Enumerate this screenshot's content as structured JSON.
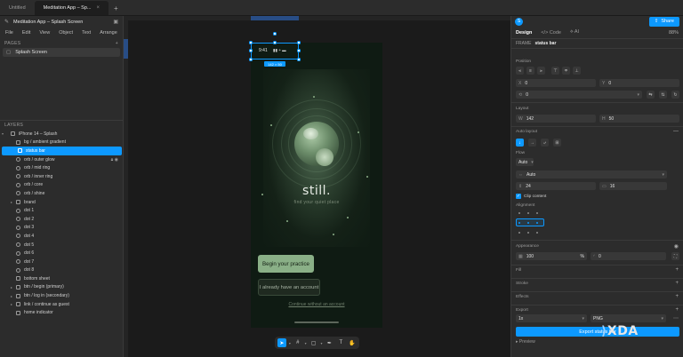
{
  "tabs": [
    {
      "label": "Untitled",
      "active": false
    },
    {
      "label": "Meditation App – Sp...",
      "active": true
    }
  ],
  "file": {
    "name": "Meditation App – Splash Screen"
  },
  "menu": [
    "File",
    "Edit",
    "View",
    "Object",
    "Text",
    "Arrange"
  ],
  "pages": {
    "header": "PAGES",
    "items": [
      "Splash Screen"
    ]
  },
  "layers": {
    "header": "LAYERS",
    "items": [
      {
        "label": "iPhone 14 – Splash",
        "type": "frame",
        "level": 0,
        "expanded": true
      },
      {
        "label": "bg / ambient gradient",
        "type": "rect",
        "level": 1
      },
      {
        "label": "status bar",
        "type": "frame",
        "level": 1,
        "selected": true
      },
      {
        "label": "orb / outer glow",
        "type": "ellipse",
        "level": 1,
        "locked": true,
        "visible": true
      },
      {
        "label": "orb / mid ring",
        "type": "ellipse",
        "level": 1
      },
      {
        "label": "orb / inner ring",
        "type": "ellipse",
        "level": 1
      },
      {
        "label": "orb / core",
        "type": "ellipse",
        "level": 1
      },
      {
        "label": "orb / shine",
        "type": "ellipse",
        "level": 1
      },
      {
        "label": "brand",
        "type": "group",
        "level": 1
      },
      {
        "label": "dot 1",
        "type": "ellipse",
        "level": 1
      },
      {
        "label": "dot 2",
        "type": "ellipse",
        "level": 1
      },
      {
        "label": "dot 3",
        "type": "ellipse",
        "level": 1
      },
      {
        "label": "dot 4",
        "type": "ellipse",
        "level": 1
      },
      {
        "label": "dot 5",
        "type": "ellipse",
        "level": 1
      },
      {
        "label": "dot 6",
        "type": "ellipse",
        "level": 1
      },
      {
        "label": "dot 7",
        "type": "ellipse",
        "level": 1
      },
      {
        "label": "dot 8",
        "type": "ellipse",
        "level": 1
      },
      {
        "label": "bottom sheet",
        "type": "rect",
        "level": 1
      },
      {
        "label": "btn / begin (primary)",
        "type": "group",
        "level": 1
      },
      {
        "label": "btn / log in (secondary)",
        "type": "group",
        "level": 1
      },
      {
        "label": "link / continue as guest",
        "type": "group",
        "level": 1
      },
      {
        "label": "home indicator",
        "type": "rect",
        "level": 1
      }
    ]
  },
  "canvas": {
    "frame_label": "",
    "status_time": "9:41",
    "status_icons": "▮▮ ◓ ▬",
    "selection_size": "142 × 50",
    "title": "still.",
    "tagline": "find your quiet place",
    "primary_button": "Begin your practice",
    "secondary_button": "I already have an account",
    "guest_link": "Continue without an account"
  },
  "right": {
    "avatar": "S",
    "share_label": "Share",
    "tabs": [
      "Design",
      "Code",
      "AI"
    ],
    "zoom": "88%",
    "frame_type": "FRAME",
    "frame_name": "status bar",
    "position": {
      "label": "Position",
      "x": "0",
      "y": "0",
      "rotation": "0"
    },
    "layout": {
      "label": "Layout",
      "w": "142",
      "h": "50"
    },
    "auto_layout": {
      "label": "Auto layout"
    },
    "flow": {
      "label": "Flow",
      "value": "Auto"
    },
    "size_mode": "Auto",
    "gap": "24",
    "padding": "16",
    "clip_content": "Clip content",
    "alignment": "Alignment",
    "appearance": {
      "label": "Appearance",
      "opacity": "100",
      "opacity_unit": "%",
      "radius": "0"
    },
    "fill": "Fill",
    "stroke": "Stroke",
    "effects": "Effects",
    "export": {
      "label": "Export",
      "scale": "1x",
      "format": "PNG",
      "button": "Export status bar",
      "preview": "Preview"
    }
  },
  "watermark": "XDA",
  "colors": {
    "accent": "#0d99ff",
    "primary_button": "#8ab087",
    "phone_bg": "#0f1b13"
  }
}
